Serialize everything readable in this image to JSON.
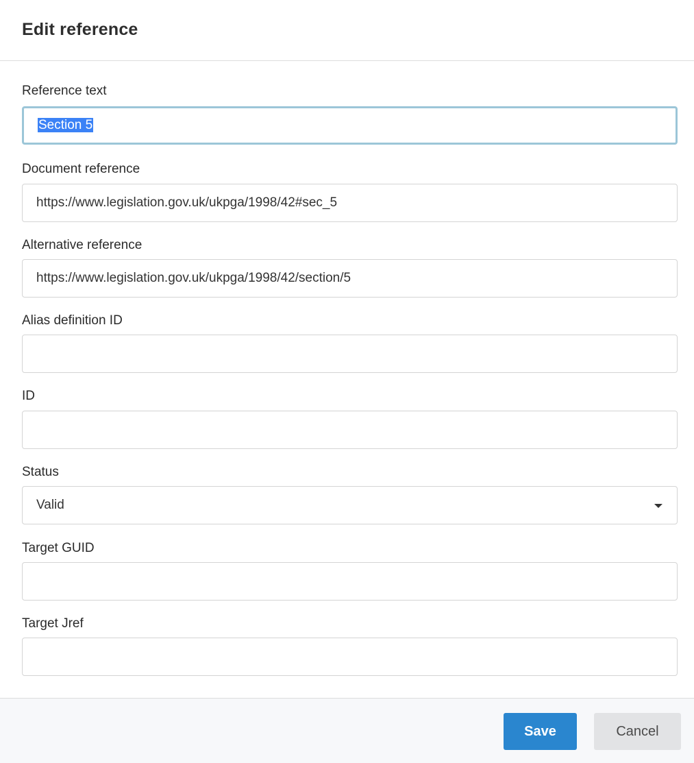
{
  "dialog": {
    "title": "Edit reference"
  },
  "fields": {
    "reference_text": {
      "label": "Reference text",
      "value": "Section 5"
    },
    "document_reference": {
      "label": "Document reference",
      "value": "https://www.legislation.gov.uk/ukpga/1998/42#sec_5"
    },
    "alternative_reference": {
      "label": "Alternative reference",
      "value": "https://www.legislation.gov.uk/ukpga/1998/42/section/5"
    },
    "alias_definition_id": {
      "label": "Alias definition ID",
      "value": ""
    },
    "id": {
      "label": "ID",
      "value": ""
    },
    "status": {
      "label": "Status",
      "selected": "Valid"
    },
    "target_guid": {
      "label": "Target GUID",
      "value": ""
    },
    "target_jref": {
      "label": "Target Jref",
      "value": ""
    }
  },
  "footer": {
    "save_label": "Save",
    "cancel_label": "Cancel"
  },
  "colors": {
    "primary": "#2a86cf",
    "focus_border": "#9cc6d8",
    "selection": "#3b82f6"
  },
  "icons": {
    "status_dropdown": "caret-down-icon"
  }
}
